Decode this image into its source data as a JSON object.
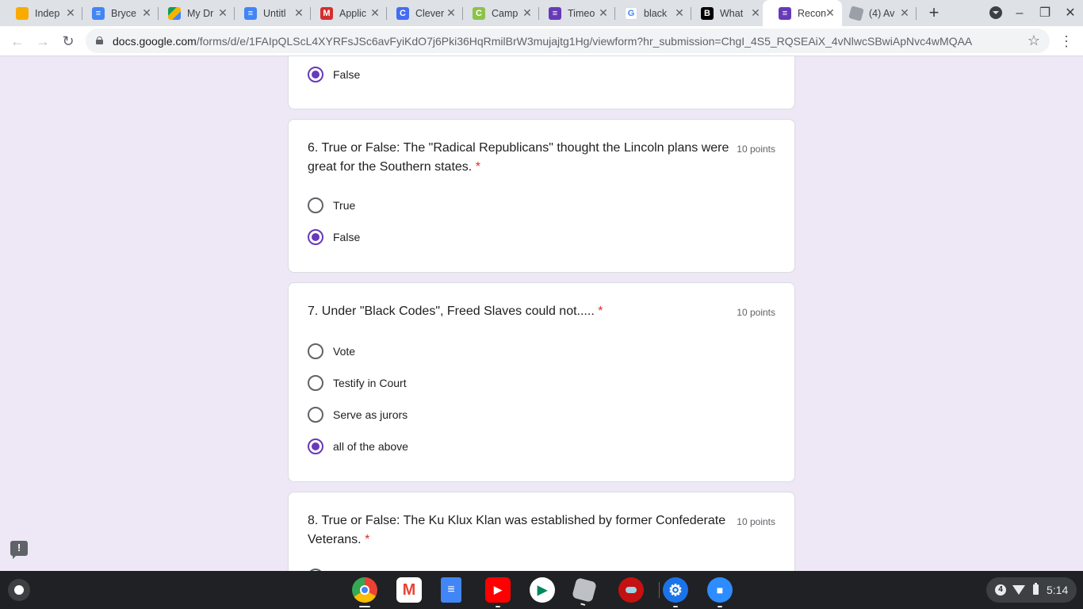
{
  "browser": {
    "tabs": [
      {
        "title": "Indep",
        "icon": "google-classroom-icon",
        "active": false
      },
      {
        "title": "Bryce",
        "icon": "google-docs-icon",
        "active": false
      },
      {
        "title": "My Dr",
        "icon": "google-drive-icon",
        "active": false
      },
      {
        "title": "Untitl",
        "icon": "google-docs-icon",
        "active": false
      },
      {
        "title": "Applic",
        "icon": "mcgraw-hill-icon",
        "active": false
      },
      {
        "title": "Clever",
        "icon": "clever-icon",
        "active": false
      },
      {
        "title": "Camp",
        "icon": "campus-icon",
        "active": false
      },
      {
        "title": "Timeo",
        "icon": "google-forms-icon",
        "active": false
      },
      {
        "title": "black",
        "icon": "google-search-icon",
        "active": false
      },
      {
        "title": "What",
        "icon": "brainly-icon",
        "active": false
      },
      {
        "title": "Recon",
        "icon": "google-forms-icon",
        "active": true
      },
      {
        "title": "(4) Av",
        "icon": "roblox-icon",
        "active": false
      }
    ],
    "url_host": "docs.google.com",
    "url_path": "/forms/d/e/1FAIpQLScL4XYRFsJSc6avFyiKdO7j6Pki36HqRmilBrW3mujajtg1Hg/viewform?hr_submission=ChgI_4S5_RQSEAiX_4vNlwcSBwiApNvc4wMQAA",
    "accent_color": "#673ab7"
  },
  "form": {
    "required_marker": "*",
    "partial_card": {
      "options": [
        {
          "label": "False",
          "selected": true
        }
      ]
    },
    "questions": [
      {
        "text": "6. True or False: The \"Radical Republicans\" thought the Lincoln plans were great for the Southern states.",
        "points": "10 points",
        "options": [
          {
            "label": "True",
            "selected": false
          },
          {
            "label": "False",
            "selected": true
          }
        ]
      },
      {
        "text": "7. Under \"Black Codes\", Freed Slaves could not.....",
        "points": "10 points",
        "options": [
          {
            "label": "Vote",
            "selected": false
          },
          {
            "label": "Testify in Court",
            "selected": false
          },
          {
            "label": "Serve as jurors",
            "selected": false
          },
          {
            "label": "all of the above",
            "selected": true
          }
        ]
      },
      {
        "text": "8. True or False: The Ku Klux Klan was established by former Confederate Veterans.",
        "points": "10 points",
        "options": []
      }
    ],
    "report_icon": "!"
  },
  "shelf": {
    "apps": [
      {
        "name": "chrome-icon",
        "color": "#4285f4"
      },
      {
        "name": "gmail-icon",
        "color": "#ea4335"
      },
      {
        "name": "google-docs-icon",
        "color": "#4285f4"
      },
      {
        "name": "youtube-icon",
        "color": "#ff0000"
      },
      {
        "name": "play-store-icon",
        "color": "#01875f"
      },
      {
        "name": "roblox-icon",
        "color": "#bdc1c6"
      },
      {
        "name": "among-us-icon",
        "color": "#c51111"
      },
      {
        "name": "settings-icon",
        "color": "#1a73e8"
      },
      {
        "name": "zoom-icon",
        "color": "#2d8cff"
      }
    ],
    "notification_count": "4",
    "time": "5:14"
  }
}
